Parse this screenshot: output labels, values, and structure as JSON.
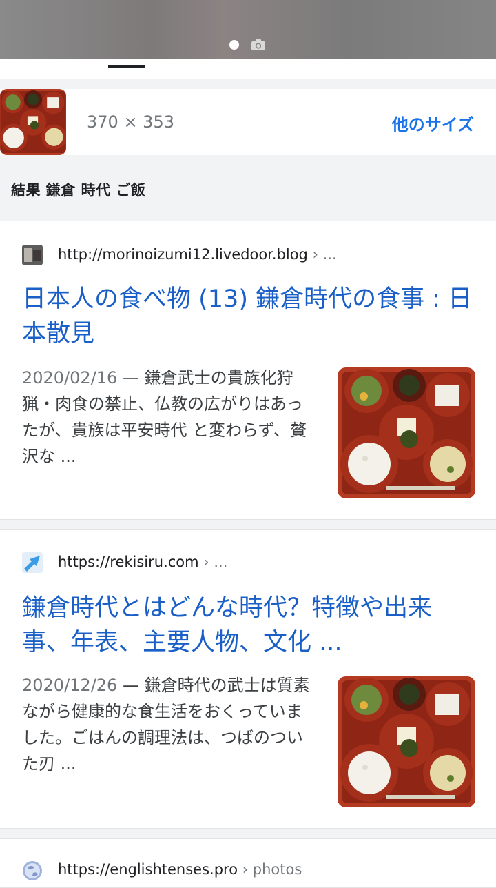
{
  "header": {
    "camera_icon": "camera-icon"
  },
  "image_info": {
    "dimensions": "370 × 353",
    "more_sizes_label": "他のサイズ"
  },
  "results_label": "結果 鎌倉 時代 ご飯",
  "colors": {
    "link": "#1a5fc7",
    "accent": "#1a73e8",
    "tray_red": "#b43a21"
  },
  "results": [
    {
      "domain": "http://morinoizumi12.livedoor.blog",
      "crumb": " › ...",
      "title": "日本人の食べ物 (13) 鎌倉時代の食事 : 日本散見",
      "date": "2020/02/16",
      "snippet": " — 鎌倉武士の貴族化狩猟・肉食の禁止、仏教の広がりはあったが、貴族は平安時代 と変わらず、贅沢な ..."
    },
    {
      "domain": "https://rekisiru.com",
      "crumb": " › ...",
      "title": "鎌倉時代とはどんな時代？特徴や出来事、年表、主要人物、文化 ...",
      "date": "2020/12/26",
      "snippet": " — 鎌倉時代の武士は質素ながら健康的な食生活をおくっていました。ごはんの調理法は、つばのついた刃 ..."
    },
    {
      "domain": "https://englishtenses.pro",
      "crumb": " › photos"
    }
  ]
}
